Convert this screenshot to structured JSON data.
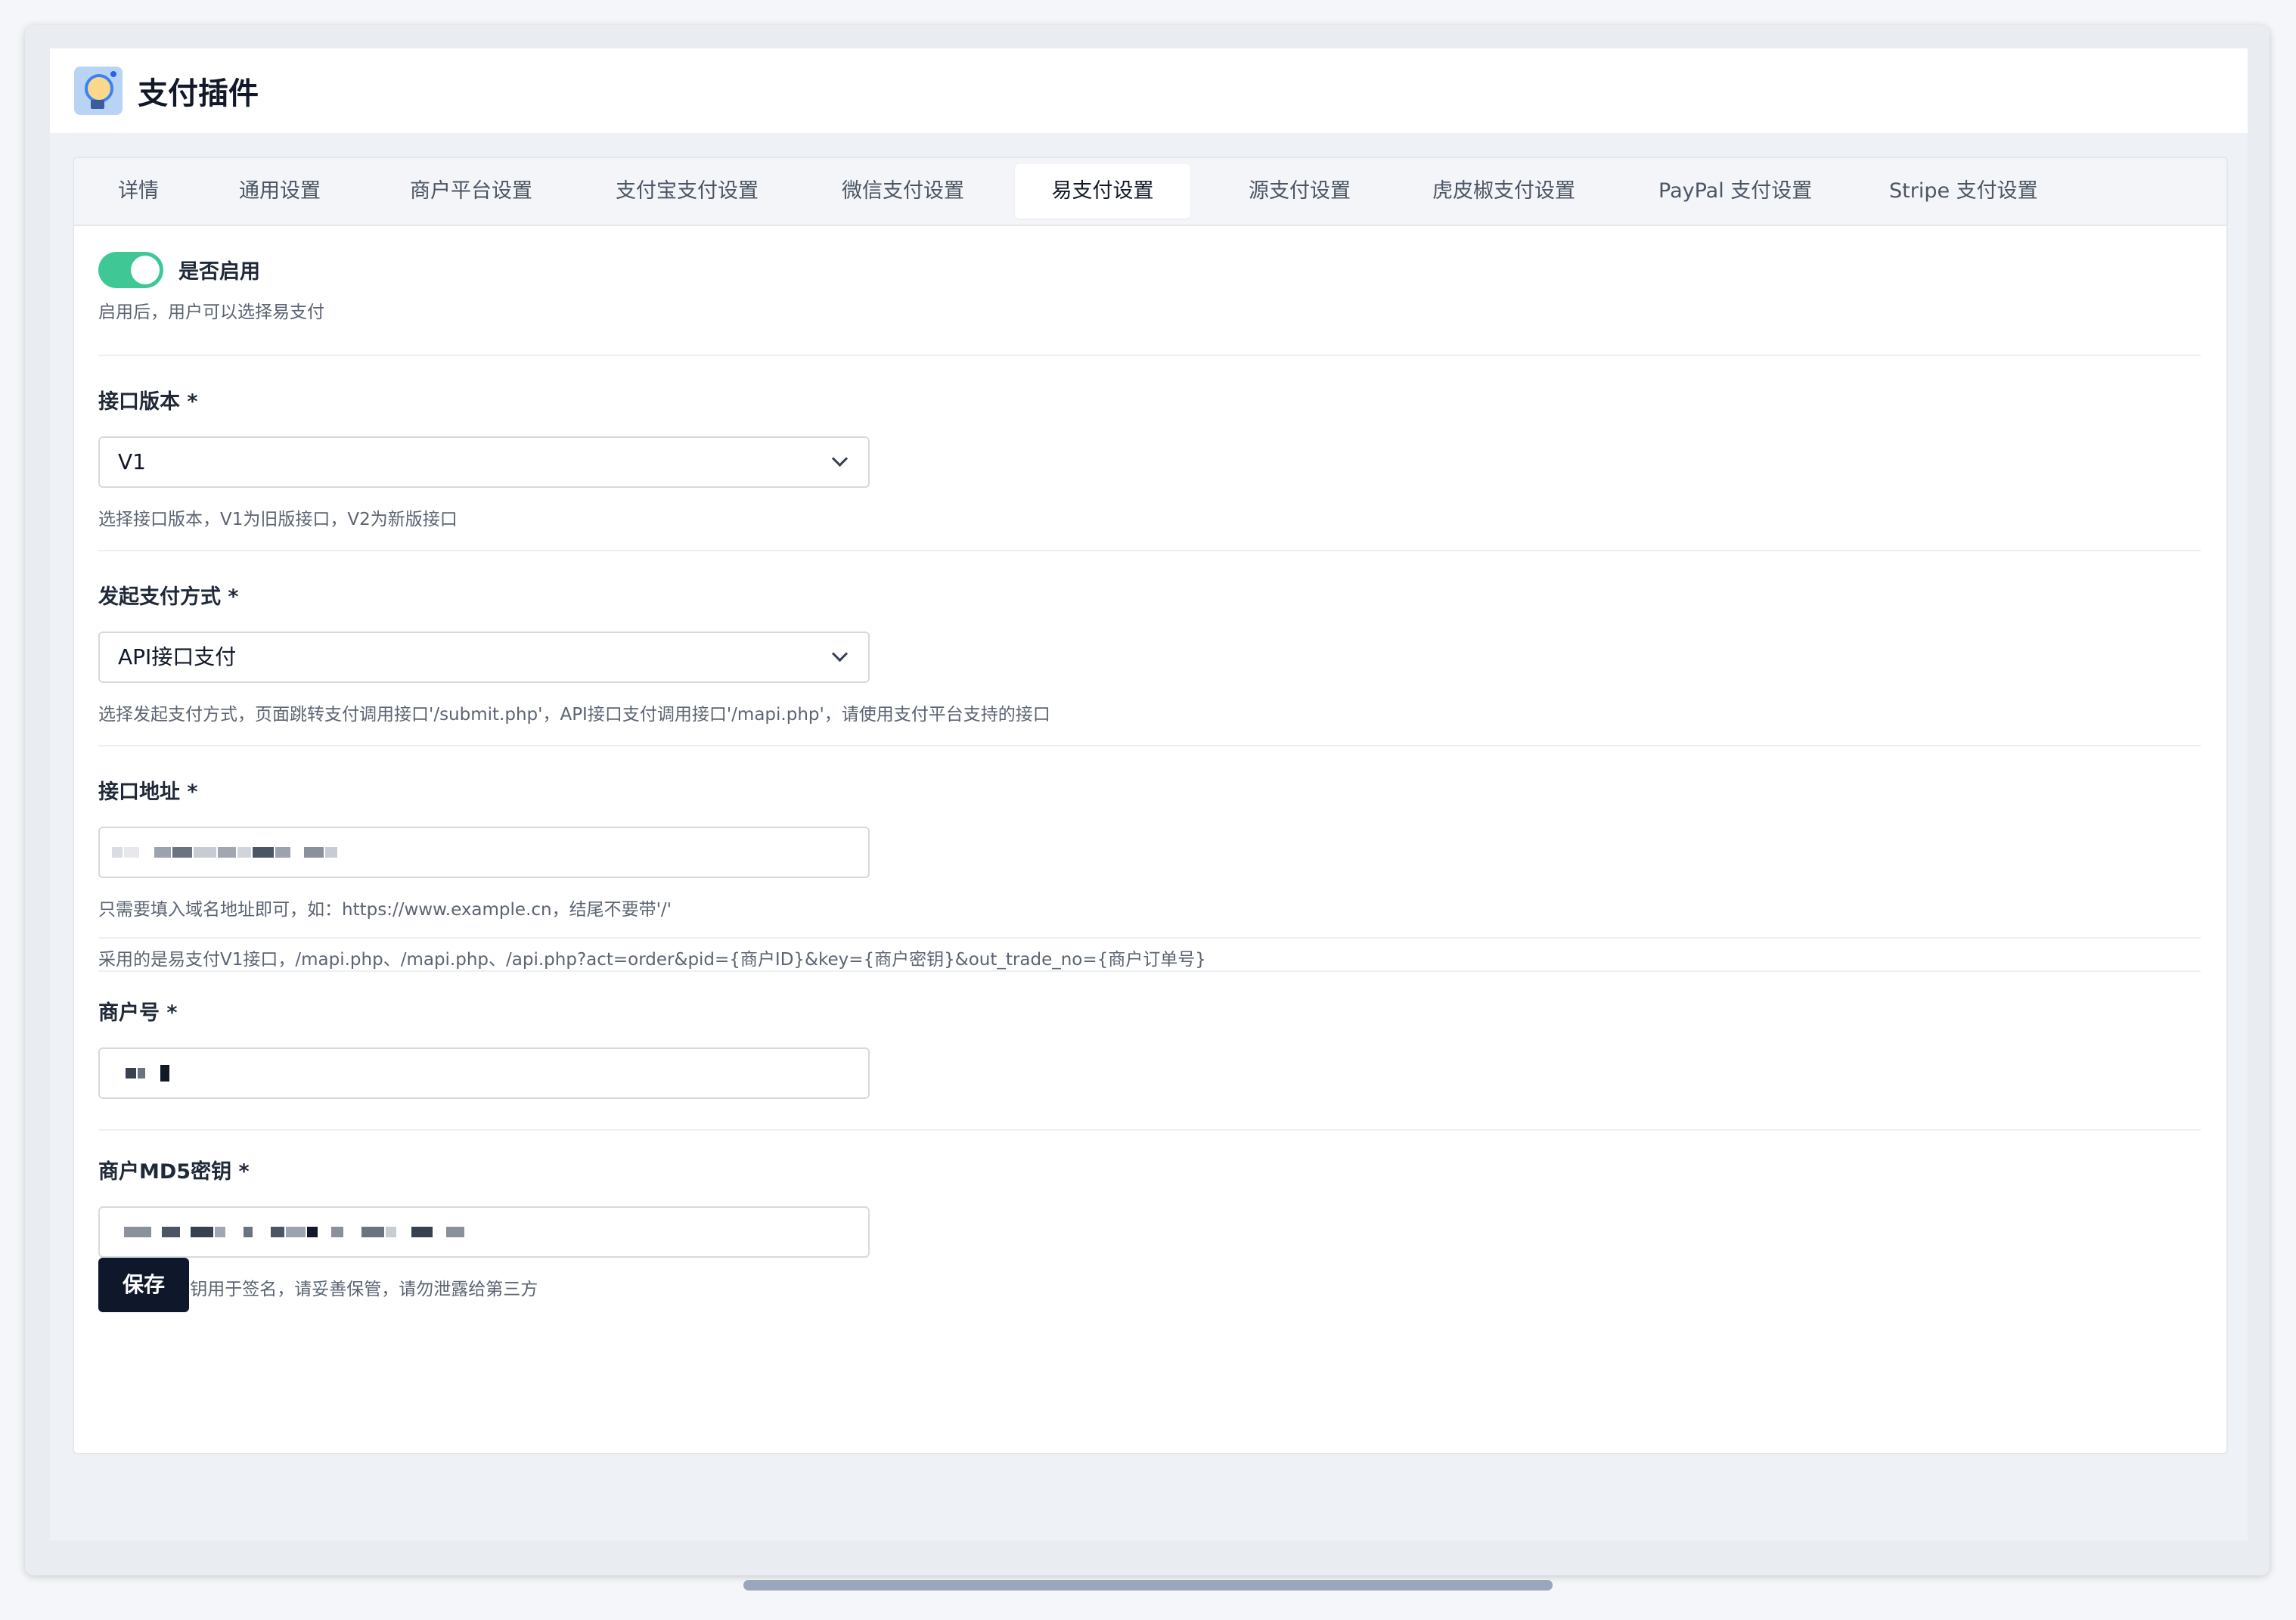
{
  "header": {
    "title": "支付插件"
  },
  "tabs": [
    {
      "label": "详情",
      "active": false
    },
    {
      "label": "通用设置",
      "active": false
    },
    {
      "label": "商户平台设置",
      "active": false
    },
    {
      "label": "支付宝支付设置",
      "active": false
    },
    {
      "label": "微信支付设置",
      "active": false
    },
    {
      "label": "易支付设置",
      "active": true
    },
    {
      "label": "源支付设置",
      "active": false
    },
    {
      "label": "虎皮椒支付设置",
      "active": false
    },
    {
      "label": "PayPal 支付设置",
      "active": false
    },
    {
      "label": "Stripe 支付设置",
      "active": false
    }
  ],
  "enable": {
    "label": "是否启用",
    "hint": "启用后，用户可以选择易支付",
    "on": true
  },
  "api_version": {
    "label": "接口版本 *",
    "value": "V1",
    "hint": "选择接口版本，V1为旧版接口，V2为新版接口"
  },
  "pay_method": {
    "label": "发起支付方式 *",
    "value": "API接口支付",
    "hint": "选择发起支付方式，页面跳转支付调用接口'/submit.php'，API接口支付调用接口'/mapi.php'，请使用支付平台支持的接口"
  },
  "api_url": {
    "label": "接口地址 *",
    "hint": "只需要填入域名地址即可，如：https://www.example.cn，结尾不要带'/'",
    "note": "采用的是易支付V1接口，/mapi.php、/mapi.php、/api.php?act=order&pid={商户ID}&key={商户密钥}&out_trade_no={商户订单号}"
  },
  "merchant_id": {
    "label": "商户号 *"
  },
  "merchant_key": {
    "label": "商户MD5密钥 *",
    "hint": "商户MD5密钥用于签名，请妥善保管，请勿泄露给第三方"
  },
  "save_label": "保存",
  "colors": {
    "toggle_on": "#3fc795",
    "primary_button": "#0f172a",
    "scrollbar": "#9aa6bb"
  }
}
